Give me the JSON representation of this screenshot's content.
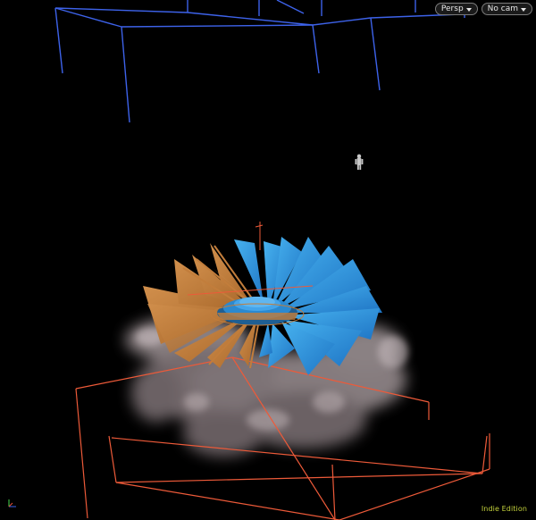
{
  "viewport": {
    "view_menu": {
      "label": "Persp",
      "icon": "chevron-down-icon"
    },
    "camera_menu": {
      "label": "No cam",
      "icon": "chevron-down-icon"
    },
    "edition_label": "Indie Edition"
  },
  "colors": {
    "background": "#000000",
    "bounding_box_blue": "#3d62e9",
    "bounding_box_orange": "#ed5a39",
    "blades_blue": "#2e97e0",
    "blades_orange": "#c27d3b",
    "smoke": "#b7aaad",
    "edition_text": "#c4d23c"
  }
}
